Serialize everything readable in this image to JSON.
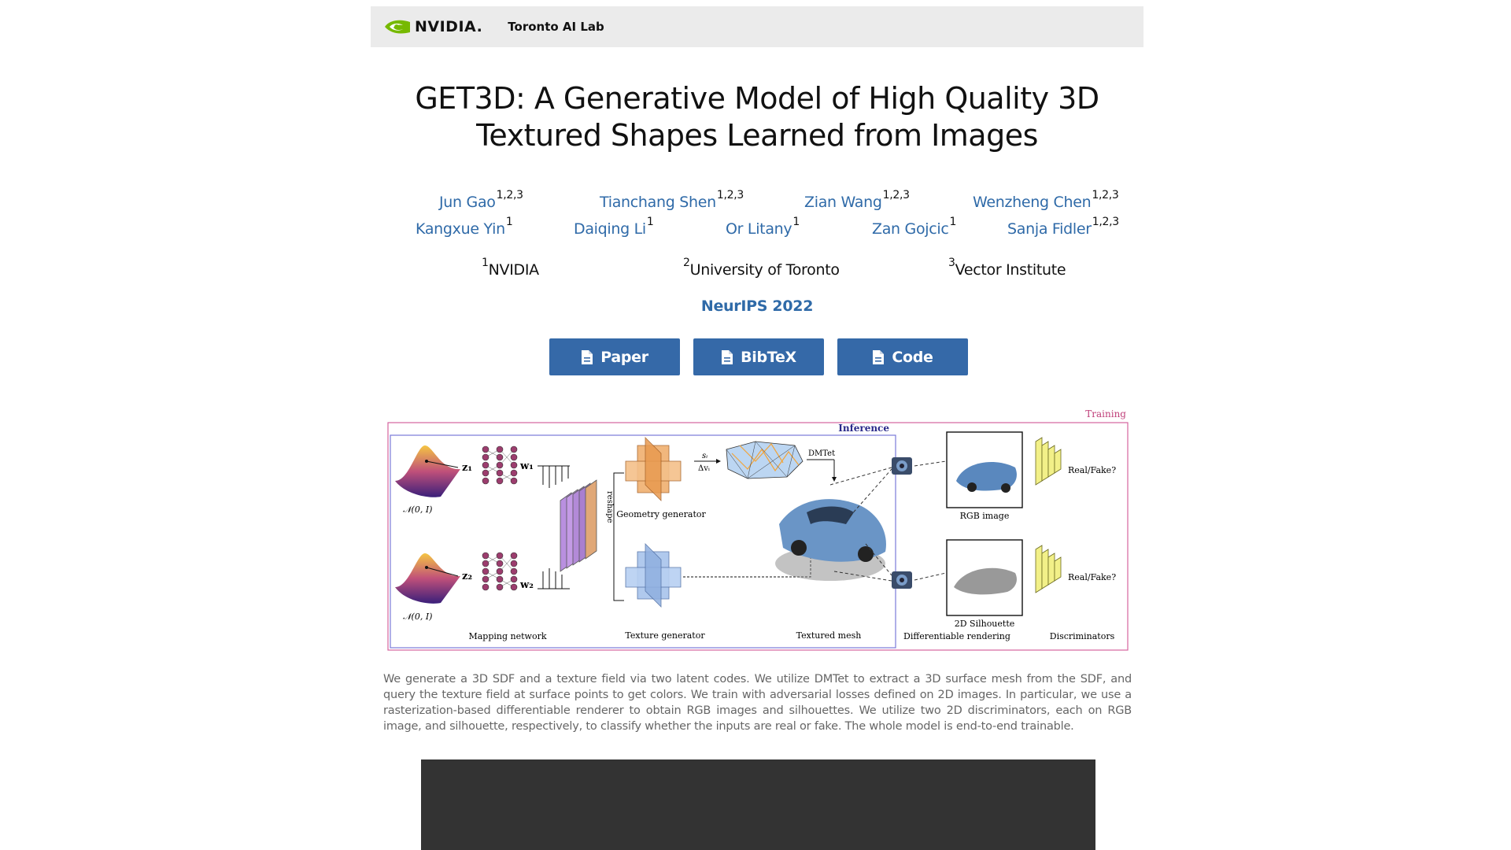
{
  "header": {
    "logo_text": "NVIDIA.",
    "lab_name": "Toronto AI Lab"
  },
  "title": "GET3D: A Generative Model of High Quality 3D Textured Shapes Learned from Images",
  "authors": [
    {
      "name": "Jun Gao",
      "sup": "1,2,3"
    },
    {
      "name": "Tianchang Shen",
      "sup": "1,2,3"
    },
    {
      "name": "Zian Wang",
      "sup": "1,2,3"
    },
    {
      "name": "Wenzheng Chen",
      "sup": "1,2,3"
    },
    {
      "name": "Kangxue Yin",
      "sup": "1"
    },
    {
      "name": "Daiqing Li",
      "sup": "1"
    },
    {
      "name": "Or Litany",
      "sup": "1"
    },
    {
      "name": "Zan Gojcic",
      "sup": "1"
    },
    {
      "name": "Sanja Fidler",
      "sup": "1,2,3"
    }
  ],
  "affiliations": [
    {
      "sup": "1",
      "name": "NVIDIA"
    },
    {
      "sup": "2",
      "name": "University of Toronto"
    },
    {
      "sup": "3",
      "name": "Vector Institute"
    }
  ],
  "venue": "NeurIPS 2022",
  "buttons": [
    {
      "label": "Paper",
      "icon": "file-icon"
    },
    {
      "label": "BibTeX",
      "icon": "file-icon"
    },
    {
      "label": "Code",
      "icon": "file-icon"
    }
  ],
  "figure": {
    "training_label": "Training",
    "inference_label": "Inference",
    "z1": "z₁",
    "z2": "z₂",
    "w1": "w₁",
    "w2": "w₂",
    "normal_dist": "𝒩(0, I)",
    "reshape": "reshape",
    "si_label": "sᵢ",
    "dv_label": "Δvᵢ",
    "dmtet": "DMTet",
    "geometry_generator": "Geometry generator",
    "texture_generator": "Texture generator",
    "textured_mesh": "Textured mesh",
    "mapping_network": "Mapping network",
    "rgb_image": "RGB image",
    "silhouette": "2D Silhouette",
    "differentiable_rendering": "Differentiable rendering",
    "discriminators": "Discriminators",
    "real_fake": "Real/Fake?",
    "colors": {
      "training_box": "#d4639e",
      "inference_box": "#7a7ad8",
      "accent": "#2f6aa8"
    }
  },
  "caption": "We generate a 3D SDF and a texture field via two latent codes. We utilize DMTet to extract a 3D surface mesh from the SDF, and query the texture field at surface points to get colors. We train with adversarial losses defined on 2D images. In particular, we use a rasterization-based differentiable renderer to obtain RGB images and silhouettes. We utilize two 2D discriminators, each on RGB image, and silhouette, respectively, to classify whether the inputs are real or fake. The whole model is end-to-end trainable."
}
